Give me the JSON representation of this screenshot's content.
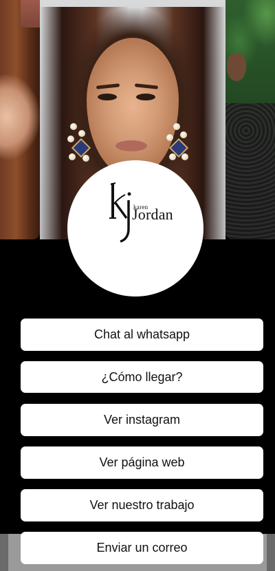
{
  "brand": {
    "monogram": "kj",
    "name_small": "karen",
    "name_big": "Jordan"
  },
  "links": [
    {
      "label": "Chat al whatsapp"
    },
    {
      "label": "¿Cómo llegar?"
    },
    {
      "label": "Ver instagram"
    },
    {
      "label": "Ver página web"
    },
    {
      "label": "Ver nuestro trabajo"
    },
    {
      "label": "Enviar un correo"
    }
  ],
  "colors": {
    "background": "#000000",
    "button": "#ffffff",
    "button_text": "#111111"
  }
}
